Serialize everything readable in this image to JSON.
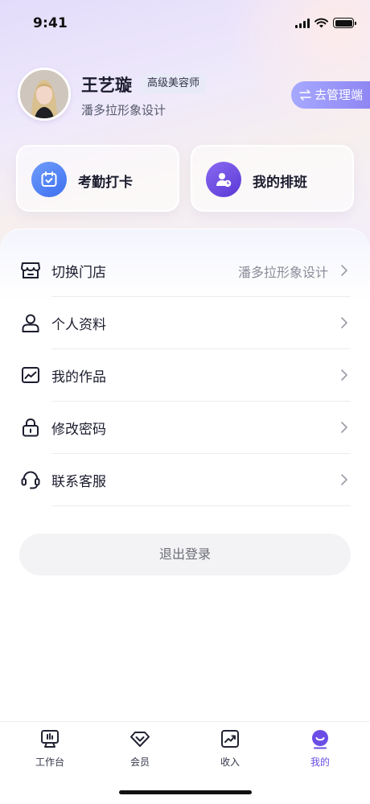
{
  "status_bar": {
    "time": "9:41"
  },
  "profile": {
    "name": "王艺璇",
    "title_badge": "高级美容师",
    "store": "潘多拉形象设计",
    "admin_button": "去管理端"
  },
  "quick_actions": [
    {
      "label": "考勤打卡",
      "icon": "calendar-check-icon",
      "color": "#4a7cf3"
    },
    {
      "label": "我的排班",
      "icon": "user-clock-icon",
      "color": "#6a4ae3"
    }
  ],
  "menu": [
    {
      "label": "切换门店",
      "value": "潘多拉形象设计",
      "icon": "store-icon"
    },
    {
      "label": "个人资料",
      "value": "",
      "icon": "user-icon"
    },
    {
      "label": "我的作品",
      "value": "",
      "icon": "gallery-icon"
    },
    {
      "label": "修改密码",
      "value": "",
      "icon": "lock-icon"
    },
    {
      "label": "联系客服",
      "value": "",
      "icon": "headset-icon"
    }
  ],
  "logout_button": "退出登录",
  "tabs": [
    {
      "label": "工作台",
      "icon": "workbench-icon",
      "active": false
    },
    {
      "label": "会员",
      "icon": "diamond-icon",
      "active": false
    },
    {
      "label": "收入",
      "icon": "trend-chart-icon",
      "active": false
    },
    {
      "label": "我的",
      "icon": "smile-profile-icon",
      "active": true
    }
  ],
  "colors": {
    "accent": "#6b4de6",
    "blue": "#4a7cf3",
    "text": "#1b1c2e",
    "muted": "#8a8d99"
  }
}
